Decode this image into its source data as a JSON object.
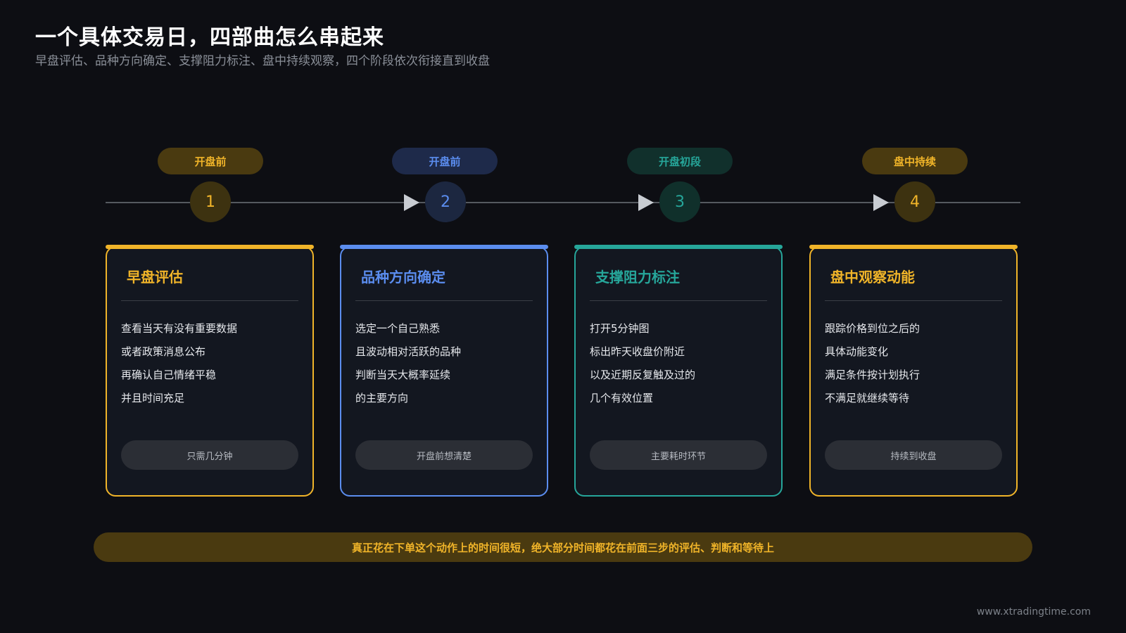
{
  "header": {
    "title": "一个具体交易日，四部曲怎么串起来",
    "subtitle": "早盘评估、品种方向确定、支撑阻力标注、盘中持续观察，四个阶段依次衔接直到收盘"
  },
  "colors": {
    "background": "#0d0e13",
    "gold": "#f0b429",
    "blue": "#5b8def",
    "teal": "#26a69a"
  },
  "steps": [
    {
      "number": "1",
      "phase": "开盘前",
      "title": "早盘评估",
      "lines": [
        "查看当天有没有重要数据",
        "或者政策消息公布",
        "再确认自己情绪平稳",
        "并且时间充足"
      ],
      "note": "只需几分钟",
      "accent": "#f0b429"
    },
    {
      "number": "2",
      "phase": "开盘前",
      "title": "品种方向确定",
      "lines": [
        "选定一个自己熟悉",
        "且波动相对活跃的品种",
        "判断当天大概率延续",
        "的主要方向"
      ],
      "note": "开盘前想清楚",
      "accent": "#5b8def"
    },
    {
      "number": "3",
      "phase": "开盘初段",
      "title": "支撑阻力标注",
      "lines": [
        "打开5分钟图",
        "标出昨天收盘价附近",
        "以及近期反复触及过的",
        "几个有效位置"
      ],
      "note": "主要耗时环节",
      "accent": "#26a69a"
    },
    {
      "number": "4",
      "phase": "盘中持续",
      "title": "盘中观察动能",
      "lines": [
        "跟踪价格到位之后的",
        "具体动能变化",
        "满足条件按计划执行",
        "不满足就继续等待"
      ],
      "note": "持续到收盘",
      "accent": "#f0b429"
    }
  ],
  "footer": {
    "banner": "真正花在下单这个动作上的时间很短，绝大部分时间都花在前面三步的评估、判断和等待上",
    "watermark": "www.xtradingtime.com"
  }
}
